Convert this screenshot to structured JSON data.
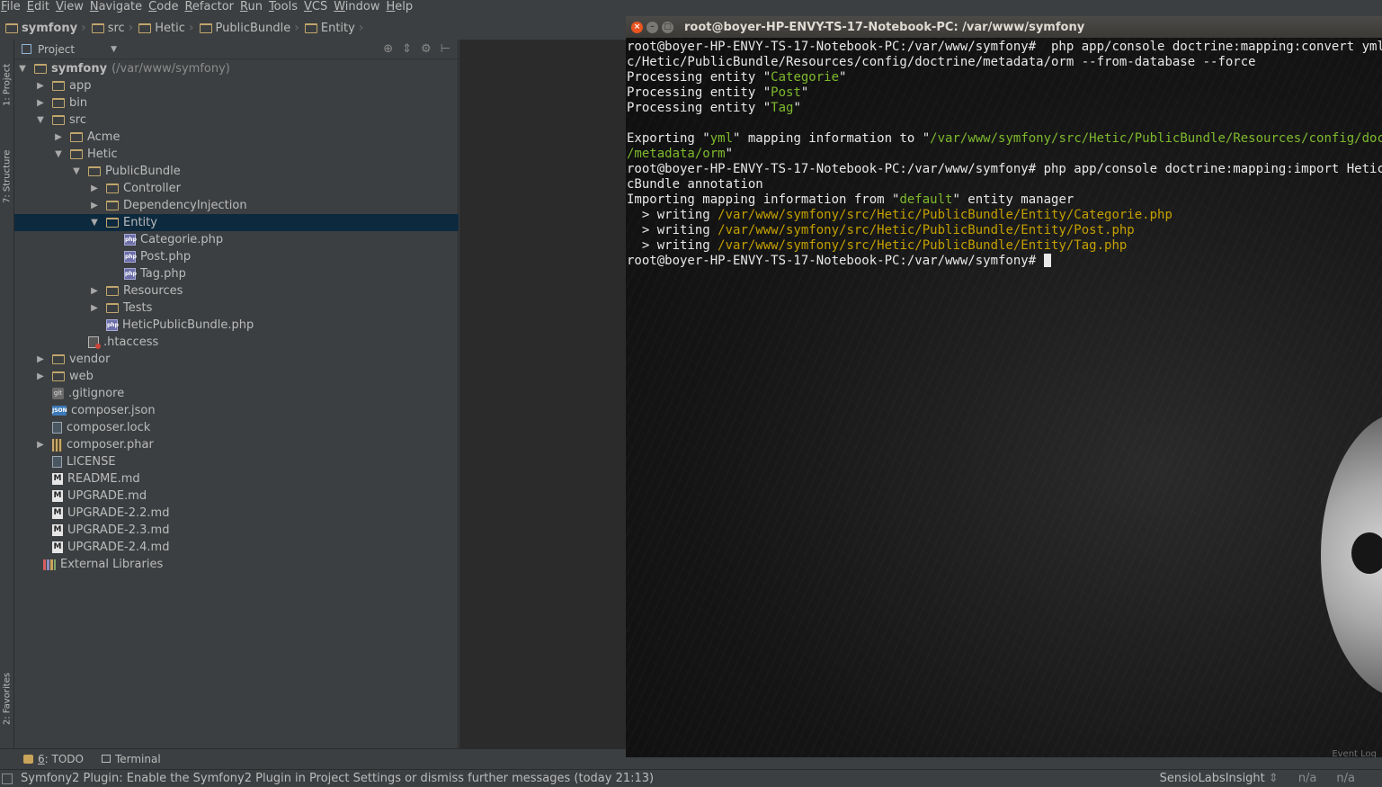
{
  "menu": [
    "File",
    "Edit",
    "View",
    "Navigate",
    "Code",
    "Refactor",
    "Run",
    "Tools",
    "VCS",
    "Window",
    "Help"
  ],
  "breadcrumb": [
    "symfony",
    "src",
    "Hetic",
    "PublicBundle",
    "Entity"
  ],
  "left_strip": {
    "project_tab": "1: Project",
    "structure_tab": "7: Structure",
    "favorites_tab": "2: Favorites"
  },
  "project_panel": {
    "title": "Project",
    "tree": [
      {
        "label": "symfony",
        "extra": "(/var/www/symfony)",
        "level": 0,
        "arrow": "down",
        "icon": "folder",
        "bold": true
      },
      {
        "label": "app",
        "level": 1,
        "arrow": "right",
        "icon": "folder"
      },
      {
        "label": "bin",
        "level": 1,
        "arrow": "right",
        "icon": "folder"
      },
      {
        "label": "src",
        "level": 1,
        "arrow": "down",
        "icon": "folder"
      },
      {
        "label": "Acme",
        "level": 2,
        "arrow": "right",
        "icon": "folder"
      },
      {
        "label": "Hetic",
        "level": 2,
        "arrow": "down",
        "icon": "folder"
      },
      {
        "label": "PublicBundle",
        "level": 3,
        "arrow": "down",
        "icon": "folder"
      },
      {
        "label": "Controller",
        "level": 4,
        "arrow": "right",
        "icon": "folder"
      },
      {
        "label": "DependencyInjection",
        "level": 4,
        "arrow": "right",
        "icon": "folder"
      },
      {
        "label": "Entity",
        "level": 4,
        "arrow": "down",
        "icon": "folder",
        "selected": true
      },
      {
        "label": "Categorie.php",
        "level": 5,
        "arrow": "",
        "icon": "php"
      },
      {
        "label": "Post.php",
        "level": 5,
        "arrow": "",
        "icon": "php"
      },
      {
        "label": "Tag.php",
        "level": 5,
        "arrow": "",
        "icon": "php"
      },
      {
        "label": "Resources",
        "level": 4,
        "arrow": "right",
        "icon": "folder"
      },
      {
        "label": "Tests",
        "level": 4,
        "arrow": "right",
        "icon": "folder"
      },
      {
        "label": "HeticPublicBundle.php",
        "level": 4,
        "arrow": "",
        "icon": "php"
      },
      {
        "label": ".htaccess",
        "level": 3,
        "arrow": "",
        "icon": "htaccess"
      },
      {
        "label": "vendor",
        "level": 1,
        "arrow": "right",
        "icon": "folder"
      },
      {
        "label": "web",
        "level": 1,
        "arrow": "right",
        "icon": "folder"
      },
      {
        "label": ".gitignore",
        "level": 1,
        "arrow": "",
        "icon": "git"
      },
      {
        "label": "composer.json",
        "level": 1,
        "arrow": "",
        "icon": "json"
      },
      {
        "label": "composer.lock",
        "level": 1,
        "arrow": "",
        "icon": "txt"
      },
      {
        "label": "composer.phar",
        "level": 1,
        "arrow": "right",
        "icon": "phar"
      },
      {
        "label": "LICENSE",
        "level": 1,
        "arrow": "",
        "icon": "txt"
      },
      {
        "label": "README.md",
        "level": 1,
        "arrow": "",
        "icon": "md"
      },
      {
        "label": "UPGRADE.md",
        "level": 1,
        "arrow": "",
        "icon": "md"
      },
      {
        "label": "UPGRADE-2.2.md",
        "level": 1,
        "arrow": "",
        "icon": "md"
      },
      {
        "label": "UPGRADE-2.3.md",
        "level": 1,
        "arrow": "",
        "icon": "md"
      },
      {
        "label": "UPGRADE-2.4.md",
        "level": 1,
        "arrow": "",
        "icon": "md"
      },
      {
        "label": "External Libraries",
        "level": 0.5,
        "arrow": "",
        "icon": "lib"
      }
    ]
  },
  "terminal": {
    "title": "root@boyer-HP-ENVY-TS-17-Notebook-PC: /var/www/symfony",
    "lines": [
      [
        {
          "t": "root@boyer-HP-ENVY-TS-17-Notebook-PC:/var/www/symfony#  php app/console doctrine:mapping:convert yml ./sr"
        }
      ],
      [
        {
          "t": "c/Hetic/PublicBundle/Resources/config/doctrine/metadata/orm --from-database --force"
        }
      ],
      [
        {
          "t": "Processing entity \""
        },
        {
          "t": "Categorie",
          "c": "g"
        },
        {
          "t": "\""
        }
      ],
      [
        {
          "t": "Processing entity \""
        },
        {
          "t": "Post",
          "c": "g"
        },
        {
          "t": "\""
        }
      ],
      [
        {
          "t": "Processing entity \""
        },
        {
          "t": "Tag",
          "c": "g"
        },
        {
          "t": "\""
        }
      ],
      [
        {
          "t": ""
        }
      ],
      [
        {
          "t": "Exporting \""
        },
        {
          "t": "yml",
          "c": "g"
        },
        {
          "t": "\" mapping information to \""
        },
        {
          "t": "/var/www/symfony/src/Hetic/PublicBundle/Resources/config/doctrine",
          "c": "g"
        }
      ],
      [
        {
          "t": "/metadata/orm",
          "c": "g"
        },
        {
          "t": "\""
        }
      ],
      [
        {
          "t": "root@boyer-HP-ENVY-TS-17-Notebook-PC:/var/www/symfony# php app/console doctrine:mapping:import HeticPubli"
        }
      ],
      [
        {
          "t": "cBundle annotation"
        }
      ],
      [
        {
          "t": "Importing mapping information from \""
        },
        {
          "t": "default",
          "c": "g"
        },
        {
          "t": "\" entity manager"
        }
      ],
      [
        {
          "t": "  > writing "
        },
        {
          "t": "/var/www/symfony/src/Hetic/PublicBundle/Entity/Categorie.php",
          "c": "y"
        }
      ],
      [
        {
          "t": "  > writing "
        },
        {
          "t": "/var/www/symfony/src/Hetic/PublicBundle/Entity/Post.php",
          "c": "y"
        }
      ],
      [
        {
          "t": "  > writing "
        },
        {
          "t": "/var/www/symfony/src/Hetic/PublicBundle/Entity/Tag.php",
          "c": "y"
        }
      ],
      [
        {
          "t": "root@boyer-HP-ENVY-TS-17-Notebook-PC:/var/www/symfony# "
        },
        {
          "cursor": true
        }
      ]
    ],
    "event_log": "Event Log"
  },
  "bottom_tabs": {
    "todo_num": "6",
    "todo_label": ": TODO",
    "terminal_label": "Terminal"
  },
  "status": {
    "message": "Symfony2 Plugin: Enable the Symfony2 Plugin in Project Settings or dismiss further messages (today 21:13)",
    "insight": "SensioLabsInsight",
    "na1": "n/a",
    "na2": "n/a"
  }
}
